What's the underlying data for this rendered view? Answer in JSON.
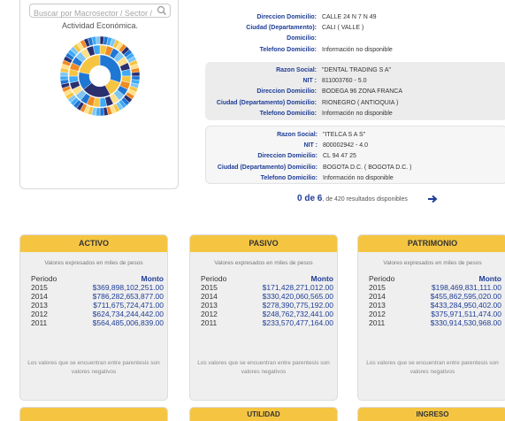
{
  "search": {
    "placeholder": "Buscar por Macrosector / Sector / Ac"
  },
  "activity_label": "Actividad Económica.",
  "companies": [
    {
      "rows": [
        {
          "label": "Direccion Domicilio:",
          "value": "CALLE 24 N 7 N 49"
        },
        {
          "label": "Ciudad (Departamento):",
          "value": "CALI ( VALLE )"
        },
        {
          "label": "Domicilio:",
          "value": ""
        },
        {
          "label": "Telefono Domicilio:",
          "value": "Información no disponible"
        }
      ]
    },
    {
      "rows": [
        {
          "label": "Razon Social:",
          "value": "\"DENTAL TRADING S A\""
        },
        {
          "label": "NIT :",
          "value": "811003760 - 5.0"
        },
        {
          "label": "Direccion Domicilio:",
          "value": "BODEGA 96 ZONA FRANCA"
        },
        {
          "label": "Ciudad (Departamento) Domicilio:",
          "value": "RIONEGRO ( ANTIOQUIA )"
        },
        {
          "label": "Telefono Domicilio:",
          "value": "Información no disponible"
        }
      ]
    },
    {
      "rows": [
        {
          "label": "Razon Social:",
          "value": "\"ITELCA S A S\""
        },
        {
          "label": "NIT :",
          "value": "800002942 - 4.0"
        },
        {
          "label": "Direccion Domicilio:",
          "value": "CL 94 47 25"
        },
        {
          "label": "Ciudad (Departamento) Domicilio:",
          "value": "BOGOTA D.C. ( BOGOTA D.C. )"
        },
        {
          "label": "Telefono Domicilio:",
          "value": "Información no disponible"
        }
      ]
    }
  ],
  "pager": {
    "count": "0 de 6",
    "suffix": ", de 420 resultados disponibles"
  },
  "finance": {
    "subtitle": "Valores expresados en miles de pesos",
    "col_period": "Periodo",
    "col_amount": "Monto",
    "note": "Los valores que se encuentran entre parentesis son valores negativos",
    "panels": [
      {
        "title": "ACTIVO",
        "rows": [
          {
            "period": "2015",
            "amount": "$369,898,102,251.00"
          },
          {
            "period": "2014",
            "amount": "$786,282,653,877.00"
          },
          {
            "period": "2013",
            "amount": "$711,675,724,471.00"
          },
          {
            "period": "2012",
            "amount": "$624,734,244,442.00"
          },
          {
            "period": "2011",
            "amount": "$564,485,006,839.00"
          }
        ]
      },
      {
        "title": "PASIVO",
        "rows": [
          {
            "period": "2015",
            "amount": "$171,428,271,012.00"
          },
          {
            "period": "2014",
            "amount": "$330,420,060,565.00"
          },
          {
            "period": "2013",
            "amount": "$278,390,775,192.00"
          },
          {
            "period": "2012",
            "amount": "$248,762,732,441.00"
          },
          {
            "period": "2011",
            "amount": "$233,570,477,164.00"
          }
        ]
      },
      {
        "title": "PATRIMONIO",
        "rows": [
          {
            "period": "2015",
            "amount": "$198,469,831,111.00"
          },
          {
            "period": "2014",
            "amount": "$455,862,595,020.00"
          },
          {
            "period": "2013",
            "amount": "$433,284,950,402.00"
          },
          {
            "period": "2012",
            "amount": "$375,971,511,474.00"
          },
          {
            "period": "2011",
            "amount": "$330,914,530,968.00"
          }
        ]
      }
    ],
    "bottom_titles": [
      "",
      "UTILIDAD",
      "INGRESO"
    ]
  },
  "colors": {
    "header_yellow": "#f5c542",
    "label_blue": "#1e3d96"
  },
  "icons": {
    "search": "search-icon",
    "next": "arrow-right-icon"
  }
}
